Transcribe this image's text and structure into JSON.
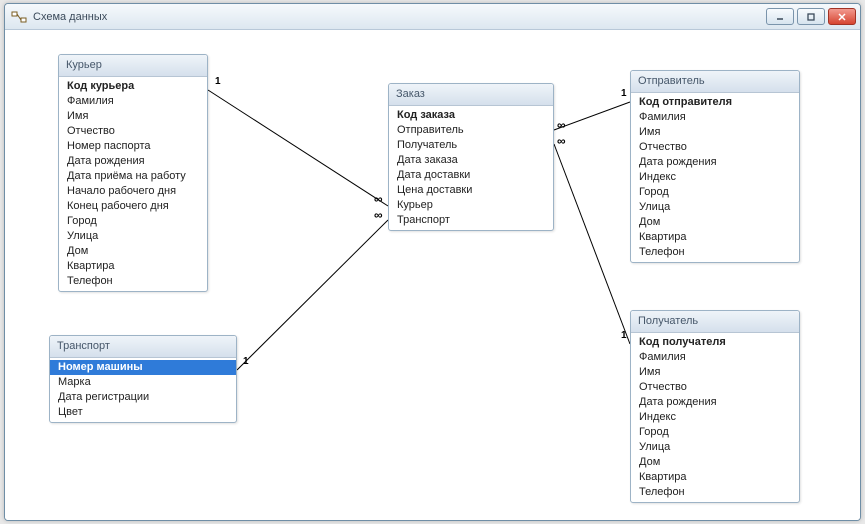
{
  "window": {
    "title": "Схема данных"
  },
  "entities": {
    "courier": {
      "title": "Курьер",
      "fields": [
        {
          "label": "Код курьера",
          "pk": true
        },
        {
          "label": "Фамилия"
        },
        {
          "label": "Имя"
        },
        {
          "label": "Отчество"
        },
        {
          "label": "Номер паспорта"
        },
        {
          "label": "Дата рождения"
        },
        {
          "label": "Дата приёма на работу"
        },
        {
          "label": "Начало рабочего дня"
        },
        {
          "label": "Конец рабочего дня"
        },
        {
          "label": "Город"
        },
        {
          "label": "Улица"
        },
        {
          "label": "Дом"
        },
        {
          "label": "Квартира"
        },
        {
          "label": "Телефон"
        }
      ]
    },
    "order": {
      "title": "Заказ",
      "fields": [
        {
          "label": "Код заказа",
          "pk": true
        },
        {
          "label": "Отправитель"
        },
        {
          "label": "Получатель"
        },
        {
          "label": "Дата заказа"
        },
        {
          "label": "Дата доставки"
        },
        {
          "label": "Цена доставки"
        },
        {
          "label": "Курьер"
        },
        {
          "label": "Транспорт"
        }
      ]
    },
    "sender": {
      "title": "Отправитель",
      "fields": [
        {
          "label": "Код отправителя",
          "pk": true
        },
        {
          "label": "Фамилия"
        },
        {
          "label": "Имя"
        },
        {
          "label": "Отчество"
        },
        {
          "label": "Дата рождения"
        },
        {
          "label": "Индекс"
        },
        {
          "label": "Город"
        },
        {
          "label": "Улица"
        },
        {
          "label": "Дом"
        },
        {
          "label": "Квартира"
        },
        {
          "label": "Телефон"
        }
      ]
    },
    "transport": {
      "title": "Транспорт",
      "fields": [
        {
          "label": "Номер машины",
          "pk": true,
          "selected": true
        },
        {
          "label": "Марка"
        },
        {
          "label": "Дата регистрации"
        },
        {
          "label": "Цвет"
        }
      ]
    },
    "recipient": {
      "title": "Получатель",
      "fields": [
        {
          "label": "Код получателя",
          "pk": true
        },
        {
          "label": "Фамилия"
        },
        {
          "label": "Имя"
        },
        {
          "label": "Отчество"
        },
        {
          "label": "Дата рождения"
        },
        {
          "label": "Индекс"
        },
        {
          "label": "Город"
        },
        {
          "label": "Улица"
        },
        {
          "label": "Дом"
        },
        {
          "label": "Квартира"
        },
        {
          "label": "Телефон"
        }
      ]
    }
  },
  "relationships": {
    "one": "1",
    "many": "∞"
  }
}
